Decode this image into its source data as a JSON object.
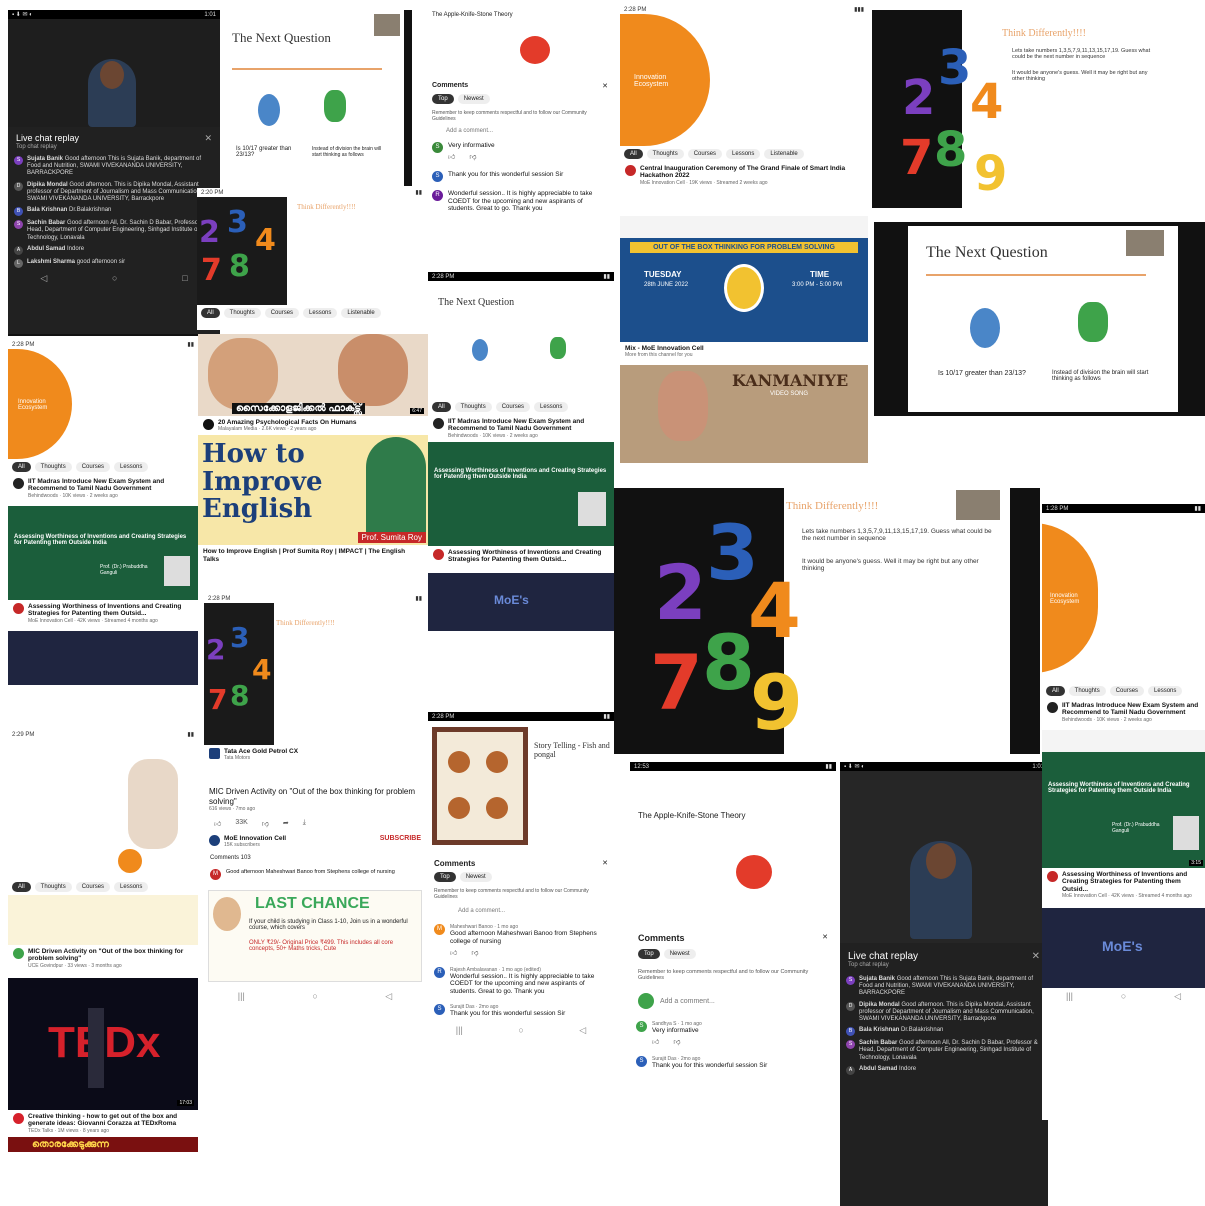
{
  "t1": {
    "status": "1:01",
    "chat_title": "Live chat replay",
    "chat_sub": "Top chat replay",
    "msgs": [
      {
        "name": "Sujata Banik",
        "text": "Good afternoon This is Sujata Banik, department of Food and Nutrition, SWAMI VIVEKANANDA UNIVERSITY, BARRACKPORE"
      },
      {
        "name": "Dipika Mondal",
        "text": "Good afternoon. This is Dipika Mondal, Assistant professor of Department of Journalism and Mass Communication, SWAMI VIVEKANANDA UNIVERSITY, Barrackpore"
      },
      {
        "name": "Bala Krishnan",
        "text": "Dr.Balakrishnan"
      },
      {
        "name": "Sachin Babar",
        "text": "Good afternoon All, Dr. Sachin D Babar, Professor & Head, Department of Computer Engineering, Sinhgad Institute of Technology, Lonavala"
      },
      {
        "name": "Abdul Samad",
        "text": "Indore"
      },
      {
        "name": "Lakshmi Sharma",
        "text": "good afternoon sir"
      }
    ]
  },
  "t2": {
    "title": "The Next Question",
    "left": "Is 10/17 greater than 23/13?",
    "right": "Instead of division the brain will start thinking as follows"
  },
  "t3": {
    "header": "The Apple-Knife-Stone Theory",
    "comments": "Comments",
    "top": "Top",
    "newest": "Newest",
    "reminder": "Remember to keep comments respectful and to follow our Community Guidelines",
    "add": "Add a comment...",
    "c1": "Very informative",
    "c2": "Thank you for this wonderful session Sir",
    "c3": "Wonderful session.. It is highly appreciable to take COEDT for the upcoming and new aspirants of students. Great to go. Thank you"
  },
  "t4": {
    "status": "2:28 PM",
    "slide_text": "Innovation Ecosystem",
    "chips": [
      "All",
      "Thoughts",
      "Courses",
      "Lessons",
      "Listenable"
    ],
    "video_title": "Central Inauguration Ceremony of The Grand Finale of Smart India Hackathon 2022",
    "video_meta": "MoE Innovation Cell · 19K views · Streamed 2 weeks ago"
  },
  "t5": {
    "title": "Think Differently!!!!",
    "b1": "Lets take numbers 1,3,5,7,9,11,13,15,17,19. Guess what could be the next number in sequence",
    "b2": "It would be anyone's guess. Well it may be right but any other thinking"
  },
  "t6": {
    "status": "2:20 PM",
    "title": "Think Differently!!!!",
    "chips": [
      "All",
      "Thoughts",
      "Courses",
      "Lessons",
      "Listenable"
    ]
  },
  "t7": {
    "banner_top": "OUT OF THE BOX THINKING FOR PROBLEM SOLVING",
    "day": "TUESDAY",
    "date": "28th JUNE 2022",
    "time_label": "TIME",
    "time": "3:00 PM - 5:00 PM",
    "mix_title": "Mix - MoE Innovation Cell",
    "mix_meta": "More from this channel for you",
    "kan": "KANMANIYE",
    "kan_sub": "VIDEO SONG"
  },
  "t8": {
    "title": "The Next Question",
    "left": "Is 10/17 greater than 23/13?",
    "right": "Instead of division the brain will start thinking as follows"
  },
  "t9": {
    "status": "2:28 PM",
    "slide_text": "Innovation Ecosystem",
    "chips": [
      "All",
      "Thoughts",
      "Courses",
      "Lessons",
      "Listenable"
    ],
    "video_title": "IIT Madras Introduce New Exam System and Recommend to Tamil Nadu Government",
    "video_meta": "Behindwoods · 10K views · 2 weeks ago",
    "banner": "Assessing Worthiness of Inventions and Creating Strategies for Patenting them Outside India",
    "speaker": "Prof. (Dr.) Prabuddha Ganguli",
    "video2": "Assessing Worthiness of Inventions and Creating Strategies for Patenting them Outsid...",
    "video2_meta": "MoE Innovation Cell · 42K views · Streamed 4 months ago"
  },
  "t10": {
    "mal_title": "സൈക്കോളജിക്കൽ ഫാക്ട്സ്",
    "duration": "6:47",
    "v_title": "20 Amazing Psychological Facts On Humans",
    "v_meta": "Malayalam Media · 2.6K views · 2 years ago",
    "how": "How to Improve English",
    "prof": "Prof. Sumita Roy",
    "how_title": "How to Improve English | Prof Sumita Roy | IMPACT | The English Talks"
  },
  "t11": {
    "status": "2:28 PM",
    "title": "The Next Question",
    "chips": [
      "All",
      "Thoughts",
      "Courses",
      "Lessons",
      "Listenable"
    ],
    "video_title": "IIT Madras Introduce New Exam System and Recommend to Tamil Nadu Government",
    "video_meta": "Behindwoods · 10K views · 2 weeks ago",
    "banner": "Assessing Worthiness of Inventions and Creating Strategies for Patenting them Outside India",
    "video2": "Assessing Worthiness of Inventions and Creating Strategies for Patenting them Outsid...",
    "moe": "MoE's"
  },
  "t12": {
    "status": "2:28 PM",
    "title": "Think Differently!!!!",
    "ad_title": "Tata Ace Gold Petrol CX",
    "ad_sub": "Tata Motors",
    "video_title": "MIC Driven Activity on \"Out of the box thinking for problem solving\"",
    "video_meta": "616 views · 7mo ago",
    "likes": "33K",
    "channel": "MoE Innovation Cell",
    "subs": "15K subscribers",
    "subscribe": "SUBSCRIBE",
    "comments_count": "Comments 103",
    "comment": "Good afternoon Maheshwari Banoo from Stephens college of nursing",
    "last": "LAST CHANCE",
    "last_body": "If your child is studying in Class 1-10, Join us in a wonderful course, which covers",
    "last_price": "ONLY ₹29/- Original Price ₹499. This includes all core concepts, 50+ Maths tricks, Cute"
  },
  "t13": {
    "status": "2:29 PM",
    "chips": [
      "All",
      "Thoughts",
      "Courses",
      "Lessons",
      "Listenable"
    ],
    "video_title": "MIC Driven Activity on \"Out of the box thinking for problem solving\"",
    "video_meta": "UCE Govindpur · 33 views · 3 months ago",
    "ted_title": "Creative thinking - how to get out of the box and generate ideas: Giovanni Corazza at TEDxRoma",
    "ted_meta": "TEDx Talks · 1M views · 8 years ago",
    "ted": "TEDx",
    "duration": "17:03",
    "mal_bottom": "തൊരക്കേടുക്കുന്ന"
  },
  "t14": {
    "status": "2:28 PM",
    "title": "Story Telling - Fish and pongal",
    "comments": "Comments",
    "top": "Top",
    "newest": "Newest",
    "reminder": "Remember to keep comments respectful and to follow our Community Guidelines",
    "add": "Add a comment...",
    "c1_name": "Maheshwari Banoo · 1 mo ago",
    "c1": "Good afternoon Maheshwari Banoo from Stephens college of nursing",
    "c2_name": "Rajesh Ambalavanan · 1 mo ago (edited)",
    "c2": "Wonderful session.. It is highly appreciable to take COEDT for the upcoming and new aspirants of students. Great to go. Thank you",
    "c3_name": "Surajit Das · 2mo ago",
    "c3": "Thank you for this wonderful session Sir"
  },
  "t15": {
    "status": "12:53",
    "header": "The Apple-Knife-Stone Theory",
    "comments": "Comments",
    "top": "Top",
    "newest": "Newest",
    "reminder": "Remember to keep comments respectful and to follow our Community Guidelines",
    "add": "Add a comment...",
    "c1_name": "Sandhya S · 1 mo ago",
    "c1": "Very informative",
    "c2_name": "Surajit Das · 2mo ago",
    "c2": "Thank you for this wonderful session Sir"
  },
  "t16": {
    "status": "1:01",
    "chat_title": "Live chat replay",
    "chat_sub": "Top chat replay",
    "msgs": [
      {
        "name": "Sujata Banik",
        "text": "Good afternoon This is Sujata Banik, department of Food and Nutrition, SWAMI VIVEKANANDA UNIVERSITY, BARRACKPORE"
      },
      {
        "name": "Dipika Mondal",
        "text": "Good afternoon. This is Dipika Mondal, Assistant professor of Department of Journalism and Mass Communication, SWAMI VIVEKANANDA UNIVERSITY, Barrackpore"
      },
      {
        "name": "Bala Krishnan",
        "text": "Dr.Balakrishnan"
      },
      {
        "name": "Sachin Babar",
        "text": "Good afternoon All, Dr. Sachin D Babar, Professor & Head, Department of Computer Engineering, Sinhgad Institute of Technology, Lonavala"
      },
      {
        "name": "Abdul Samad",
        "text": "Indore"
      }
    ]
  },
  "t17": {
    "status": "1:28 PM",
    "slide_text": "Innovation Ecosystem",
    "chips": [
      "All",
      "Thoughts",
      "Courses",
      "Lessons",
      "Listenable"
    ],
    "video_title": "IIT Madras Introduce New Exam System and Recommend to Tamil Nadu Government",
    "video_meta": "Behindwoods · 10K views · 2 weeks ago",
    "banner": "Assessing Worthiness of Inventions and Creating Strategies for Patenting them Outside India",
    "speaker": "Prof. (Dr.) Prabuddha Ganguli",
    "duration": "3:15",
    "video2": "Assessing Worthiness of Inventions and Creating Strategies for Patenting them Outsid...",
    "video2_meta": "MoE Innovation Cell · 42K views · Streamed 4 months ago",
    "moe": "MoE's"
  },
  "colors": {
    "orange": "#f08a1c",
    "purple": "#7b3fbf",
    "blue": "#2b5fb8",
    "red": "#e33b2a",
    "yellow": "#f2c230",
    "green": "#4aa84a",
    "navy": "#1c4f8c"
  }
}
